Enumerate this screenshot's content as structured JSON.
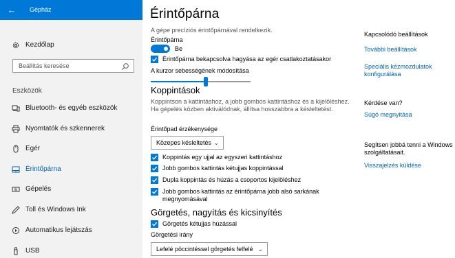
{
  "app": {
    "back_icon": "back-arrow-icon",
    "title": "Gépház"
  },
  "nav": {
    "home": {
      "label": "Kezdőlap",
      "icon": "gear-icon"
    },
    "search": {
      "placeholder": "Beállítás keresése",
      "icon": "search-icon"
    },
    "section_header": "Eszközök",
    "items": [
      {
        "label": "Bluetooth- és egyéb eszközök",
        "icon": "bluetooth-devices-icon"
      },
      {
        "label": "Nyomtatók és szkennerek",
        "icon": "printer-icon"
      },
      {
        "label": "Egér",
        "icon": "mouse-icon"
      },
      {
        "label": "Érintőpárna",
        "icon": "touchpad-icon",
        "active": true
      },
      {
        "label": "Gépelés",
        "icon": "keyboard-icon"
      },
      {
        "label": "Toll és Windows Ink",
        "icon": "pen-icon"
      },
      {
        "label": "Automatikus lejátszás",
        "icon": "autoplay-icon"
      },
      {
        "label": "USB",
        "icon": "usb-icon"
      }
    ]
  },
  "main": {
    "title": "Érintőpárna",
    "description": "A gépe precíziós érintőpárnával rendelkezik.",
    "toggle": {
      "label": "Érintőpárna",
      "state_label": "Be",
      "on": true
    },
    "keep_on_with_mouse": {
      "label": "Érintőpárna bekapcsolva hagyása az egér csatlakoztatásakor",
      "checked": true
    },
    "cursor_speed": {
      "label": "A kurzor sebességének módosítása",
      "value_fraction": 0.55
    },
    "taps": {
      "title": "Koppintások",
      "paragraph": "Koppintson a kattintáshoz, a jobb gombos kattintáshoz és a kijelöléshez. Ha gépelés közben aktiválódnak, állítsa hosszabbra a késleltetést.",
      "sensitivity_label": "Érintőpad érzékenysége",
      "sensitivity_value": "Közepes késleltetés",
      "options": [
        {
          "label": "Koppintás egy ujjal az egyszeri kattintáshoz",
          "checked": true
        },
        {
          "label": "Jobb gombos kattintás kétujjas koppintással",
          "checked": true
        },
        {
          "label": "Dupla koppintás és húzás a csoportos kijelöléshez",
          "checked": true
        },
        {
          "label_line1": "Jobb gombos kattintás az érintőpárna jobb alsó sarkának",
          "label_line2": "megnyomásával",
          "checked": true
        }
      ]
    },
    "scroll": {
      "title": "Görgetés, nagyítás és kicsinyítés",
      "two_finger": {
        "label": "Görgetés kétujjas húzással",
        "checked": true
      },
      "direction_label": "Görgetési irány",
      "direction_value": "Lefelé pöccintéssel görgetés felfelé"
    }
  },
  "side": {
    "related_heading": "Kapcsolódó beállítások",
    "more_settings": "További beállítások",
    "gestures_link": "Speciális kézmozdulatok konfigurálása",
    "question_heading": "Kérdése van?",
    "help_link": "Súgó megnyitása",
    "feedback_text": "Segítsen jobbá tenni a Windows szolgáltatásait.",
    "feedback_link": "Visszajelzés küldése"
  },
  "colors": {
    "accent": "#0078d7",
    "link": "#0063b1",
    "nav_bg": "#f2f2f2"
  }
}
